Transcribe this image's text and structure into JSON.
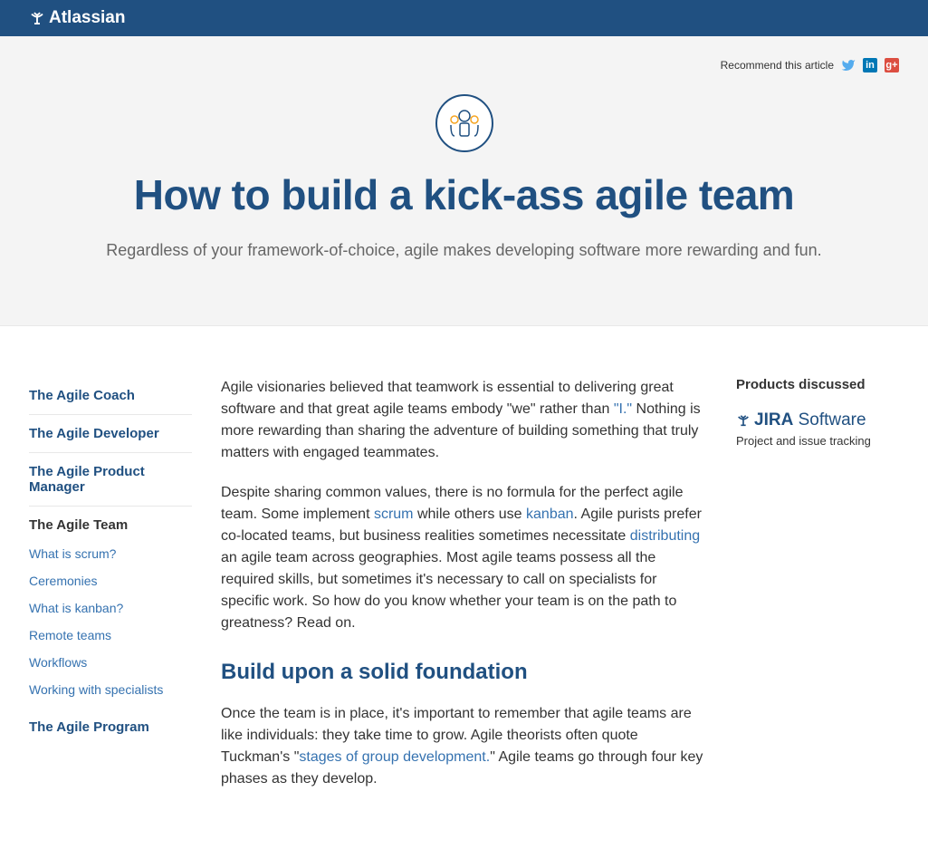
{
  "header": {
    "brand": "Atlassian"
  },
  "recommend": {
    "label": "Recommend this article"
  },
  "hero": {
    "title": "How to build a kick-ass agile team",
    "subtitle": "Regardless of your framework-of-choice, agile makes developing software more rewarding and fun."
  },
  "sidebar": {
    "sections": [
      {
        "label": "The Agile Coach"
      },
      {
        "label": "The Agile Developer"
      },
      {
        "label": "The Agile Product Manager"
      }
    ],
    "active": {
      "label": "The Agile Team"
    },
    "sublinks": [
      "What is scrum?",
      "Ceremonies",
      "What is kanban?",
      "Remote teams",
      "Workflows",
      "Working with specialists"
    ],
    "bottom": {
      "label": "The Agile Program"
    }
  },
  "article": {
    "p1a": "Agile visionaries believed that teamwork is essential to delivering great software and that great agile teams embody \"we\" rather than ",
    "p1_link": "\"I.\"",
    "p1b": " Nothing is more rewarding than sharing the adventure of building something that truly matters with engaged teammates.",
    "p2a": "Despite sharing common values, there is no formula for the perfect agile team. Some implement ",
    "p2_scrum": "scrum",
    "p2b": " while others use ",
    "p2_kanban": "kanban",
    "p2c": ". Agile purists prefer co-located teams, but business realities sometimes necessitate ",
    "p2_dist": "distributing",
    "p2d": " an agile team across geographies. Most agile teams possess all the required skills, but sometimes it's necessary to call on specialists for specific work. So how do you know whether your team is on the path to greatness? Read on.",
    "h2": "Build upon a solid foundation",
    "p3a": "Once the team is in place, it's important to remember that agile teams are like individuals: they take time to grow. Agile theorists often quote Tuckman's \"",
    "p3_link": "stages of group development.",
    "p3b": "\" Agile teams go through four key phases as they develop."
  },
  "right": {
    "heading": "Products discussed",
    "product_prefix": "JIRA",
    "product_suffix": " Software",
    "tagline": "Project and issue tracking"
  }
}
